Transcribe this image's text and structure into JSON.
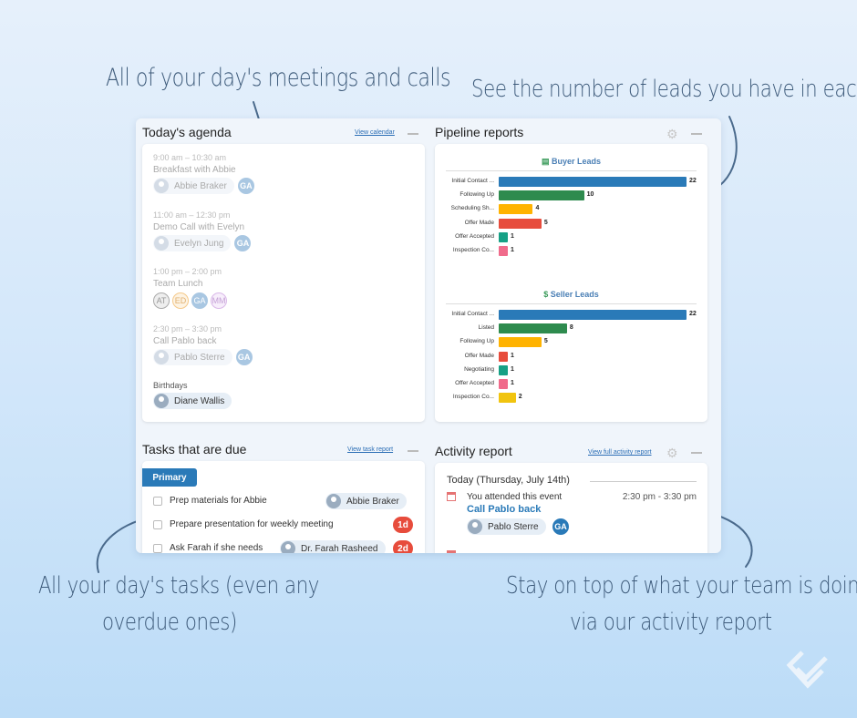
{
  "annotations": {
    "meetings": "All of your day's meetings and calls",
    "leads": "See the number of leads you have in each stage",
    "tasks_line1": "All your day's tasks (even any",
    "tasks_line2": "overdue ones)",
    "activity_line1": "Stay on top of what your team is doing",
    "activity_line2": "via our activity report"
  },
  "agenda": {
    "title": "Today's agenda",
    "link": "View calendar",
    "events": [
      {
        "time": "9:00 am  –  10:30 am",
        "name": "Breakfast with Abbie",
        "contact": "Abbie Braker",
        "owner": "GA"
      },
      {
        "time": "11:00 am  –  12:30 pm",
        "name": "Demo Call with Evelyn",
        "contact": "Evelyn Jung",
        "owner": "GA"
      },
      {
        "time": "1:00 pm  –  2:00 pm",
        "name": "Team Lunch",
        "attendees": [
          "AT",
          "ED",
          "GA",
          "MM"
        ]
      },
      {
        "time": "2:30 pm  –  3:30 pm",
        "name": "Call Pablo back",
        "contact": "Pablo Sterre",
        "owner": "GA"
      }
    ],
    "birthdays_label": "Birthdays",
    "birthday_person": "Diane Wallis"
  },
  "pipeline": {
    "title": "Pipeline reports"
  },
  "chart_data": [
    {
      "type": "bar",
      "orientation": "horizontal",
      "title": "Buyer Leads",
      "categories": [
        "Initial Contact ...",
        "Following Up",
        "Scheduling Sh...",
        "Offer Made",
        "Offer Accepted",
        "Inspection Co..."
      ],
      "values": [
        22,
        10,
        4,
        5,
        1,
        1
      ],
      "colors": [
        "#2a7ab8",
        "#2e8b4e",
        "#ffb300",
        "#e74c3c",
        "#16a085",
        "#f06b8b"
      ]
    },
    {
      "type": "bar",
      "orientation": "horizontal",
      "title": "Seller Leads",
      "categories": [
        "Initial Contact ...",
        "Listed",
        "Following Up",
        "Offer Made",
        "Negotiating",
        "Offer Accepted",
        "Inspection Co..."
      ],
      "values": [
        22,
        8,
        5,
        1,
        1,
        1,
        2
      ],
      "colors": [
        "#2a7ab8",
        "#2e8b4e",
        "#ffb300",
        "#e74c3c",
        "#16a085",
        "#f06b8b",
        "#f1c40f"
      ]
    }
  ],
  "tasks": {
    "title": "Tasks that are due",
    "link": "View task report",
    "tab": "Primary",
    "items": [
      {
        "text": "Prep materials for Abbie",
        "contact": "Abbie Braker",
        "badge": ""
      },
      {
        "text": "Prepare presentation for weekly meeting",
        "contact": "",
        "badge": "1d"
      },
      {
        "text": "Ask Farah if she needs",
        "contact": "Dr. Farah Rasheed",
        "badge": "2d"
      }
    ]
  },
  "activity": {
    "title": "Activity report",
    "link": "View full activity report",
    "day": "Today (Thursday, July 14th)",
    "entry": {
      "text": "You attended this event",
      "time": "2:30 pm - 3:30 pm",
      "event": "Call Pablo back",
      "contact": "Pablo Sterre",
      "owner": "GA"
    }
  }
}
